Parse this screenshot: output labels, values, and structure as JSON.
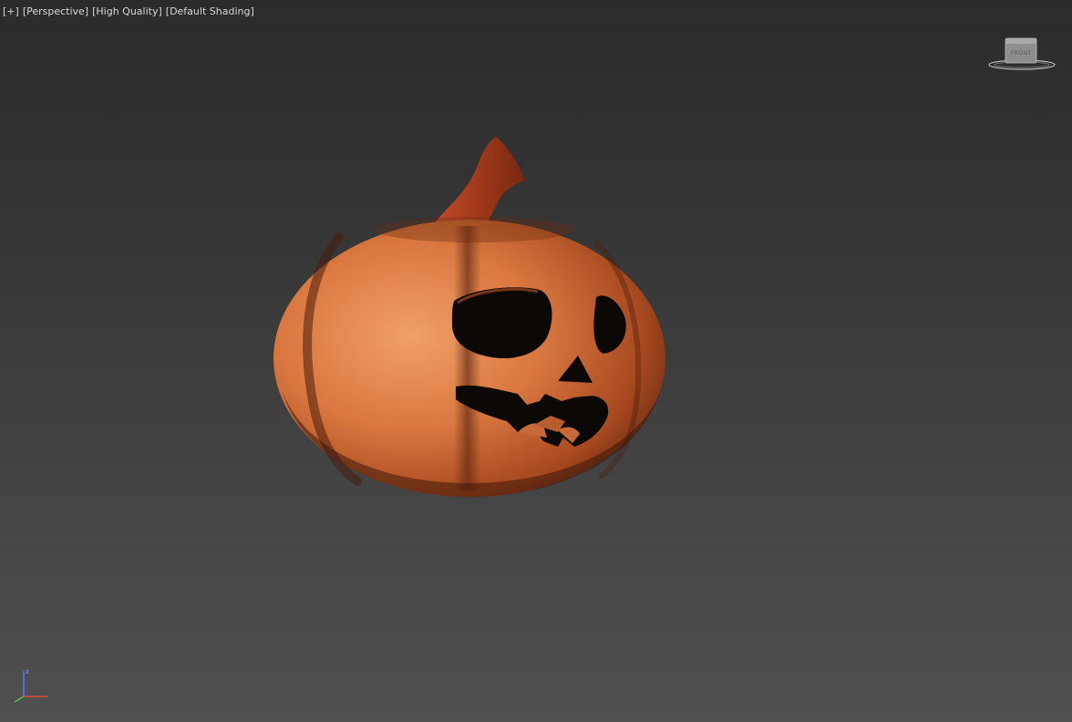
{
  "viewport": {
    "labels": {
      "plus": "[+]",
      "view": "[Perspective]",
      "quality": "[High Quality]",
      "shading": "[Default Shading]"
    },
    "viewcube": {
      "face_label": "FRONT"
    },
    "axis": {
      "z_label": "z"
    },
    "colors": {
      "pumpkin": "#d9773f",
      "stem": "#a4391c",
      "background_top": "#2b2b2b",
      "background_bottom": "#505050"
    }
  }
}
